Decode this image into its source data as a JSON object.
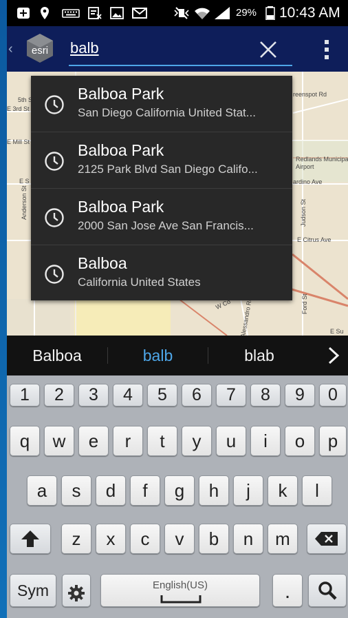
{
  "status_bar": {
    "battery_percent": "29%",
    "time": "10:43 AM"
  },
  "app_bar": {
    "logo_text": "esri",
    "search_value": "balb"
  },
  "map": {
    "labels": [
      "5th St",
      "E 3rd St",
      "E Mill St",
      "E S",
      "Anderson St",
      "reenspot Rd",
      "Redlands Municipal",
      "Airport",
      "ardino Ave",
      "Judson St",
      "E Citrus Ave",
      "Ford St",
      "Alessandro Rd",
      "W Co",
      "E Su"
    ]
  },
  "suggestions": [
    {
      "title": "Balboa Park",
      "subtitle": "San Diego California United Stat..."
    },
    {
      "title": "Balboa Park",
      "subtitle": "2125 Park Blvd San Diego Califo..."
    },
    {
      "title": "Balboa Park",
      "subtitle": "2000 San Jose Ave San Francis..."
    },
    {
      "title": "Balboa",
      "subtitle": "California United States"
    }
  ],
  "predictions": [
    "Balboa",
    "balb",
    "blab"
  ],
  "colors": {
    "highlight": "#4ea6e8",
    "appbar": "#0e1e5a"
  },
  "keyboard": {
    "numbers": [
      "1",
      "2",
      "3",
      "4",
      "5",
      "6",
      "7",
      "8",
      "9",
      "0"
    ],
    "row1": [
      "q",
      "w",
      "e",
      "r",
      "t",
      "y",
      "u",
      "i",
      "o",
      "p"
    ],
    "row2": [
      "a",
      "s",
      "d",
      "f",
      "g",
      "h",
      "j",
      "k",
      "l"
    ],
    "row3": [
      "z",
      "x",
      "c",
      "v",
      "b",
      "n",
      "m"
    ],
    "sym_label": "Sym",
    "space_label": "English(US)",
    "period_label": "."
  }
}
